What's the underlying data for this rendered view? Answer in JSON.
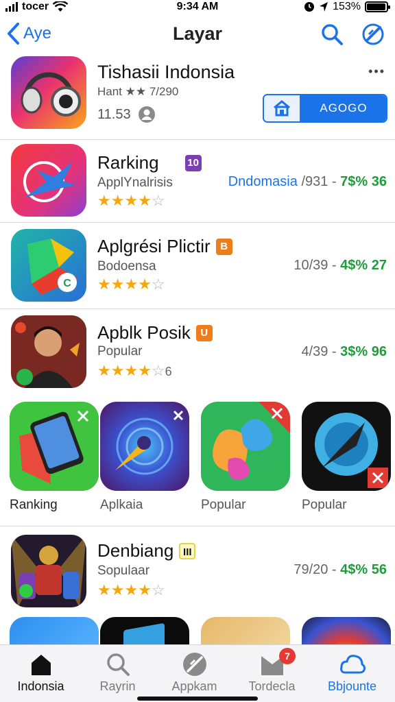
{
  "status_bar": {
    "carrier": "tocer",
    "time": "9:34 AM",
    "battery": "153%",
    "battery_level": 0.95
  },
  "nav": {
    "back_label": "Aye",
    "title": "Layar"
  },
  "featured": {
    "name": "Tishasii Indonsia",
    "rating_text": "Hant ★★ 7/290",
    "size": "11.53",
    "action_label": "AGOGO",
    "more": "•••"
  },
  "list": [
    {
      "name": "Rarking",
      "badge": "10",
      "badge_color": "#7b3fb3",
      "sub": "ApplYnalrisis",
      "stars": 4,
      "stars_extra": "",
      "meta_prefix": "Dndomasia",
      "meta_a": "/931 -",
      "meta_b": "7$% 36"
    },
    {
      "name": "Aplgrési Plictir",
      "badge": "B",
      "badge_color": "#ef7d1a",
      "sub": "Bodoensa",
      "stars": 4,
      "stars_extra": "",
      "meta_prefix": "",
      "meta_a": "10/39 -",
      "meta_b": "4$% 27"
    },
    {
      "name": "Apblk Posik",
      "badge": "U",
      "badge_color": "#ef7d1a",
      "sub": "Popular",
      "stars": 4,
      "stars_extra": "6",
      "meta_prefix": "",
      "meta_a": "4/39 -",
      "meta_b": "3$% 96"
    }
  ],
  "grid": [
    {
      "label": "Ranking"
    },
    {
      "label": "Aplkaia"
    },
    {
      "label": "Popular"
    },
    {
      "label": "Popular"
    }
  ],
  "list2": {
    "name": "Denbiang",
    "badge": "III",
    "sub": "Sopulaar",
    "stars": 4,
    "meta_a": "79/20 -",
    "meta_b": "4$% 56"
  },
  "tabs": [
    {
      "label": "Indonsia",
      "icon": "home-icon"
    },
    {
      "label": "Rayrin",
      "icon": "search-icon"
    },
    {
      "label": "Appkam",
      "icon": "apps-icon"
    },
    {
      "label": "Tordecla",
      "icon": "updates-icon",
      "badge": "7"
    },
    {
      "label": "Bbjounte",
      "icon": "cloud-icon"
    }
  ],
  "colors": {
    "accent": "#1a73e8",
    "green": "#1e9c3a",
    "star": "#f3a712"
  }
}
